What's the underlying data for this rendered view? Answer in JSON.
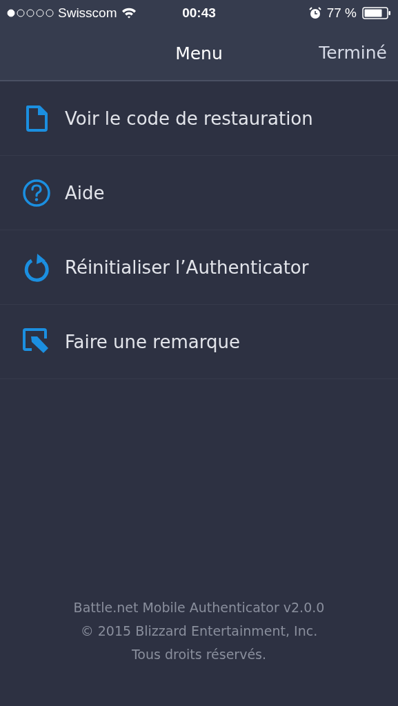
{
  "status_bar": {
    "carrier": "Swisscom",
    "time": "00:43",
    "battery": "77 %"
  },
  "nav_bar": {
    "title": "Menu",
    "done": "Terminé"
  },
  "menu_items": [
    {
      "kind": "document",
      "label": "Voir le code de restauration"
    },
    {
      "kind": "help",
      "label": "Aide"
    },
    {
      "kind": "reset",
      "label": "Réinitialiser l’Authenticator"
    },
    {
      "kind": "feedback",
      "label": "Faire une remarque"
    }
  ],
  "footer": [
    "Battle.net Mobile Authenticator v2.0.0",
    "© 2015 Blizzard Entertainment, Inc.",
    "Tous droits réservés."
  ]
}
